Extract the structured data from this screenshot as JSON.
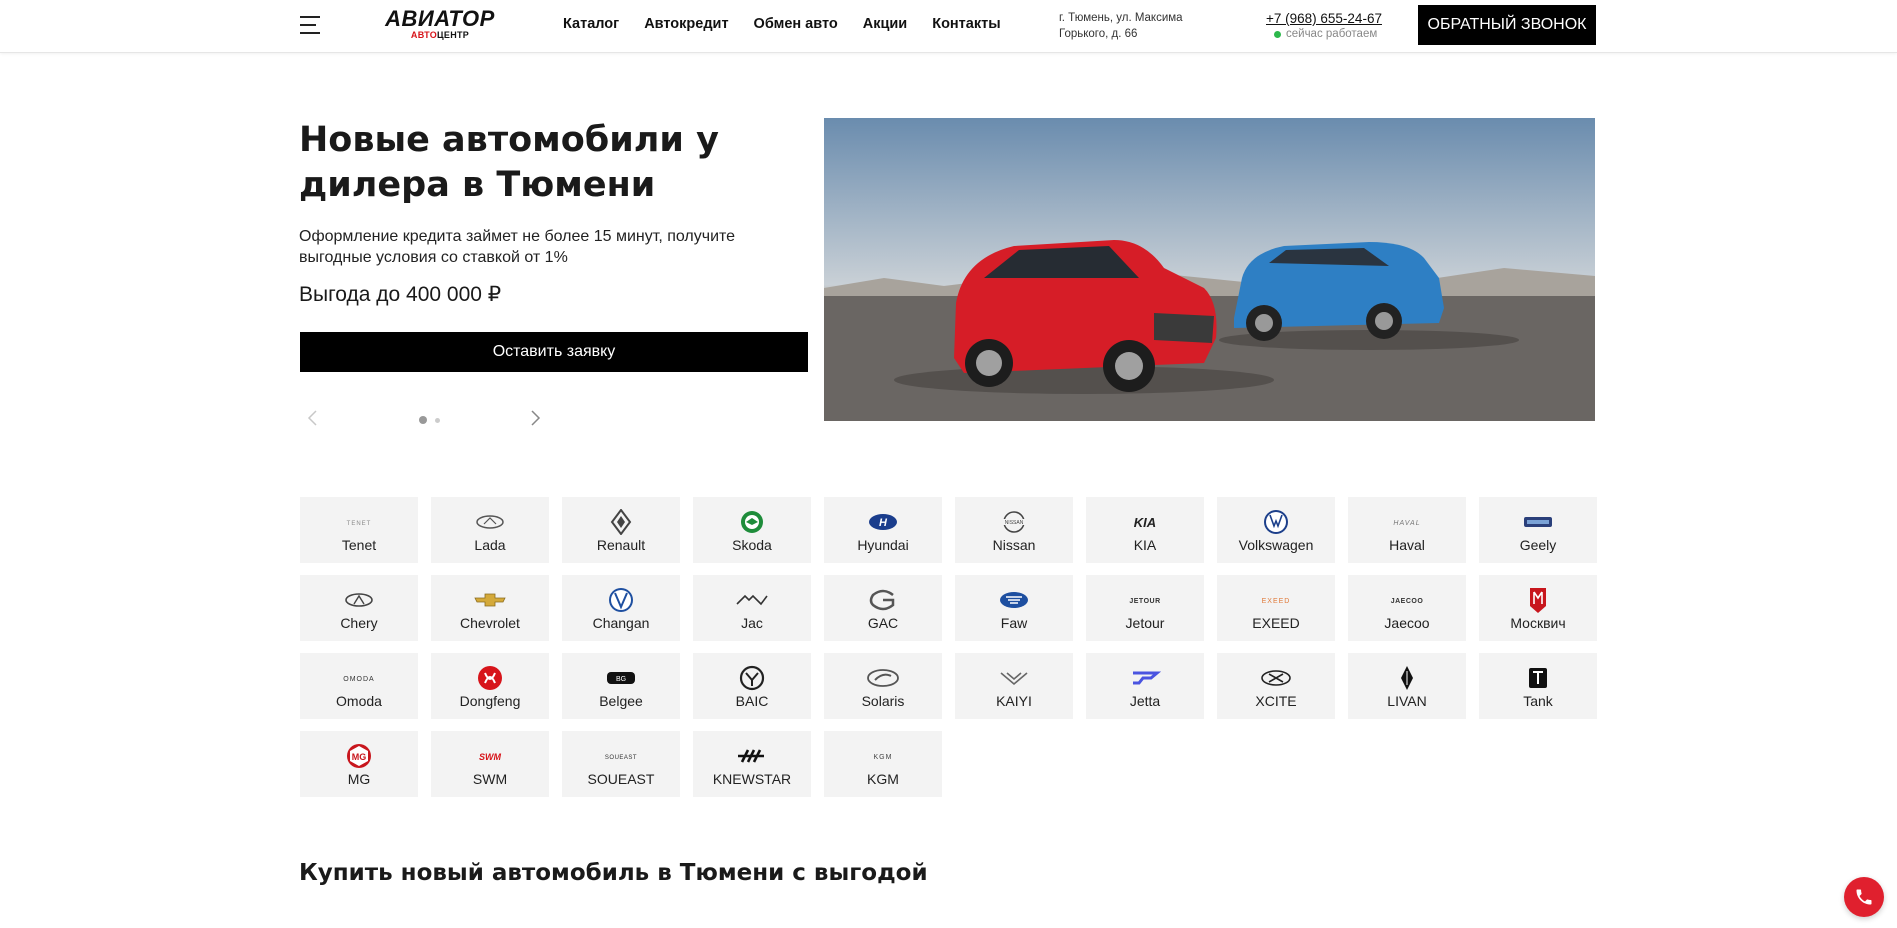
{
  "header": {
    "logo_main": "АВИАТОР",
    "logo_sub_red": "АВТО",
    "logo_sub_black": "ЦЕНТР",
    "nav": [
      "Каталог",
      "Автокредит",
      "Обмен авто",
      "Акции",
      "Контакты"
    ],
    "address": "г. Тюмень, ул. Максима Горького, д. 66",
    "phone": "+7 (968) 655-24-67",
    "status": "сейчас работаем",
    "status_color": "#2db84c",
    "callback_label": "ОБРАТНЫЙ ЗВОНОК"
  },
  "hero": {
    "title": "Новые автомобили у дилера в Тюмени",
    "subtitle": "Оформление кредита займет не более 15 минут, получите выгодные условия со ставкой от 1%",
    "benefit": "Выгода до 400 000 ₽",
    "button_label": "Оставить заявку",
    "slides_count": 2,
    "active_slide": 1
  },
  "brands": [
    {
      "name": "Tenet",
      "icon": "tenet-logo-icon"
    },
    {
      "name": "Lada",
      "icon": "lada-logo-icon"
    },
    {
      "name": "Renault",
      "icon": "renault-logo-icon"
    },
    {
      "name": "Skoda",
      "icon": "skoda-logo-icon"
    },
    {
      "name": "Hyundai",
      "icon": "hyundai-logo-icon"
    },
    {
      "name": "Nissan",
      "icon": "nissan-logo-icon"
    },
    {
      "name": "KIA",
      "icon": "kia-logo-icon"
    },
    {
      "name": "Volkswagen",
      "icon": "volkswagen-logo-icon"
    },
    {
      "name": "Haval",
      "icon": "haval-logo-icon"
    },
    {
      "name": "Geely",
      "icon": "geely-logo-icon"
    },
    {
      "name": "Chery",
      "icon": "chery-logo-icon"
    },
    {
      "name": "Chevrolet",
      "icon": "chevrolet-logo-icon"
    },
    {
      "name": "Changan",
      "icon": "changan-logo-icon"
    },
    {
      "name": "Jac",
      "icon": "jac-logo-icon"
    },
    {
      "name": "GAC",
      "icon": "gac-logo-icon"
    },
    {
      "name": "Faw",
      "icon": "faw-logo-icon"
    },
    {
      "name": "Jetour",
      "icon": "jetour-logo-icon"
    },
    {
      "name": "EXEED",
      "icon": "exeed-logo-icon"
    },
    {
      "name": "Jaecoo",
      "icon": "jaecoo-logo-icon"
    },
    {
      "name": "Москвич",
      "icon": "moskvich-logo-icon"
    },
    {
      "name": "Omoda",
      "icon": "omoda-logo-icon"
    },
    {
      "name": "Dongfeng",
      "icon": "dongfeng-logo-icon"
    },
    {
      "name": "Belgee",
      "icon": "belgee-logo-icon"
    },
    {
      "name": "BAIC",
      "icon": "baic-logo-icon"
    },
    {
      "name": "Solaris",
      "icon": "solaris-logo-icon"
    },
    {
      "name": "KAIYI",
      "icon": "kaiyi-logo-icon"
    },
    {
      "name": "Jetta",
      "icon": "jetta-logo-icon"
    },
    {
      "name": "XCITE",
      "icon": "xcite-logo-icon"
    },
    {
      "name": "LIVAN",
      "icon": "livan-logo-icon"
    },
    {
      "name": "Tank",
      "icon": "tank-logo-icon"
    },
    {
      "name": "MG",
      "icon": "mg-logo-icon"
    },
    {
      "name": "SWM",
      "icon": "swm-logo-icon"
    },
    {
      "name": "SOUEAST",
      "icon": "soueast-logo-icon"
    },
    {
      "name": "KNEWSTAR",
      "icon": "knewstar-logo-icon"
    },
    {
      "name": "KGM",
      "icon": "kgm-logo-icon"
    }
  ],
  "section": {
    "title": "Купить новый автомобиль в Тюмени с выгодой"
  },
  "colors": {
    "accent_red": "#d7141a",
    "call_button": "#e0202e",
    "tile_bg": "#f3f3f3"
  }
}
